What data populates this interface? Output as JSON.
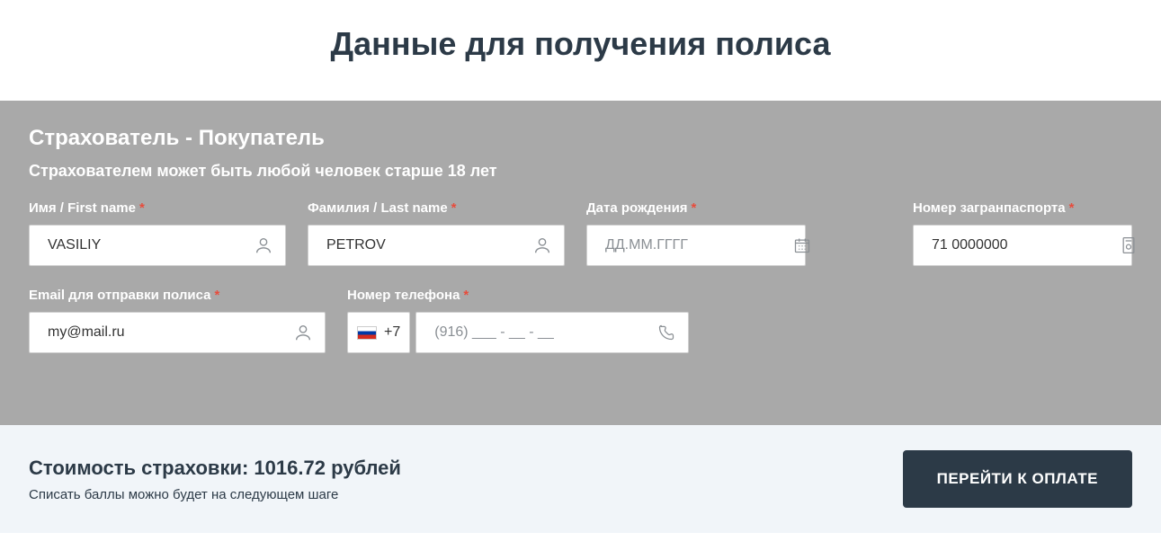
{
  "page": {
    "title": "Данные для получения полиса"
  },
  "form": {
    "section_title": "Страхователь - Покупатель",
    "section_subtitle": "Страхователем может быть любой человек старше 18 лет",
    "fields": {
      "first_name": {
        "label": "Имя / First name",
        "value": "VASILIY"
      },
      "last_name": {
        "label": "Фамилия / Last name",
        "value": "PETROV"
      },
      "birth_date": {
        "label": "Дата рождения",
        "placeholder": "ДД.ММ.ГГГГ",
        "value": ""
      },
      "passport": {
        "label": "Номер загранпаспорта",
        "value": "71 0000000"
      },
      "email": {
        "label": "Email для отправки полиса",
        "value": "my@mail.ru"
      },
      "phone": {
        "label": "Номер телефона",
        "prefix": "+7",
        "placeholder": "(916) ___ - __ - __",
        "value": ""
      }
    }
  },
  "footer": {
    "price_prefix": "Стоимость страховки: ",
    "price_value": "1016.72",
    "price_suffix": " рублей",
    "note": "Списать баллы можно будет на следующем шаге",
    "pay_button": "ПЕРЕЙТИ К ОПЛАТЕ"
  }
}
